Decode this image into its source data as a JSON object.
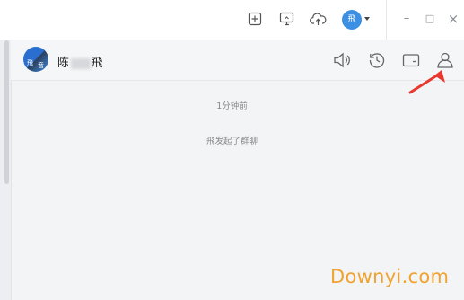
{
  "topbar": {
    "icons": [
      "add-square-icon",
      "screen-share-icon",
      "cloud-upload-icon"
    ],
    "avatar_text": "飛",
    "window_buttons": {
      "minimize": "–",
      "maximize": "□",
      "close": "×"
    }
  },
  "chat": {
    "avatar_chars": [
      "飛",
      "音"
    ],
    "name_prefix": "陈",
    "name_suffix": "飛",
    "header_icons": [
      "speaker-icon",
      "history-icon",
      "folder-icon",
      "person-icon"
    ]
  },
  "messages": {
    "timestamp": "1分钟前",
    "system_message": "飛发起了群聊"
  },
  "watermark": "Downyi.com",
  "colors": {
    "accent": "#3d8fe3",
    "arrow": "#e8392f",
    "watermark": "#f0a330"
  }
}
